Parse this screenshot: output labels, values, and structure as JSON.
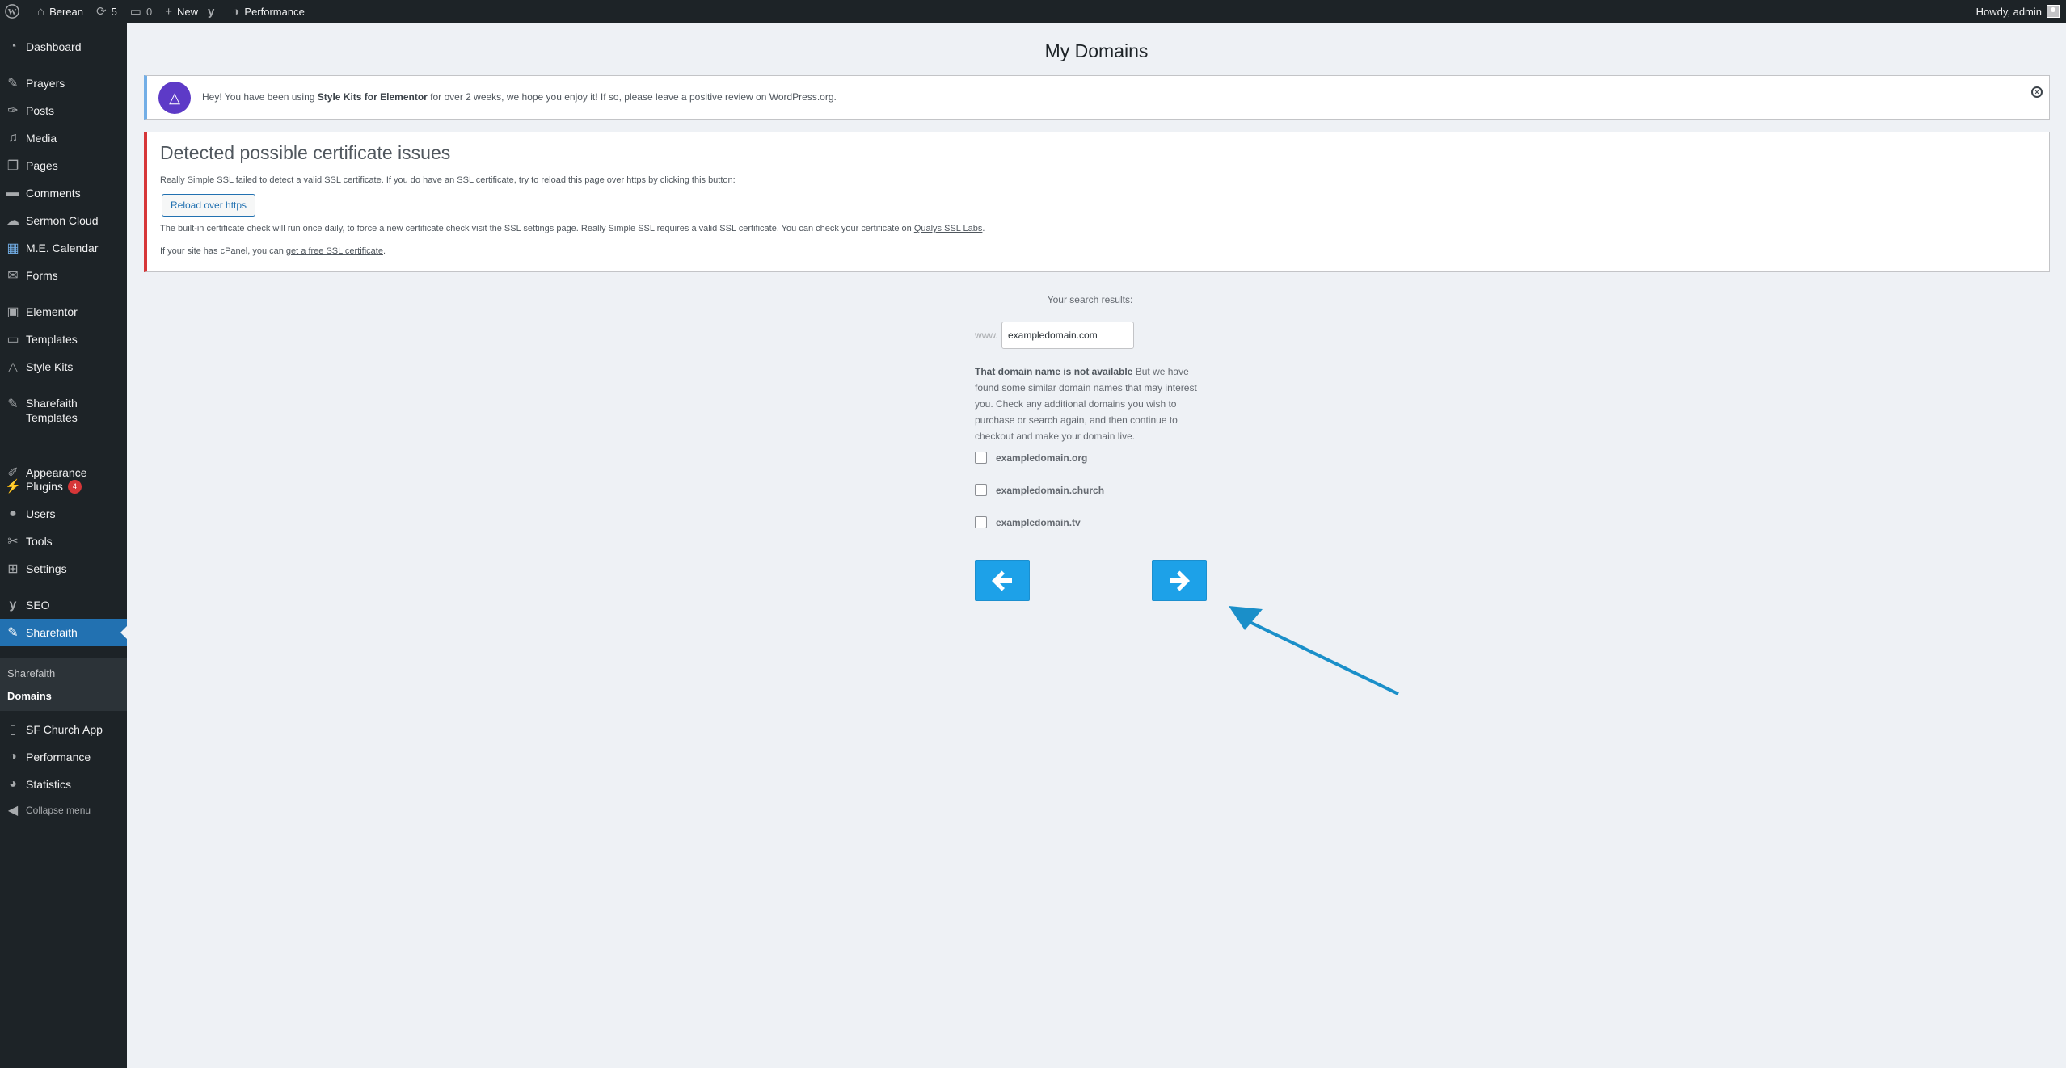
{
  "adminbar": {
    "site_name": "Berean",
    "updates_count": "5",
    "comments_count": "0",
    "new_label": "New",
    "performance_label": "Performance",
    "howdy": "Howdy, admin"
  },
  "sidebar": {
    "dashboard": "Dashboard",
    "prayers": "Prayers",
    "posts": "Posts",
    "media": "Media",
    "pages": "Pages",
    "comments": "Comments",
    "sermon_cloud": "Sermon Cloud",
    "me_calendar": "M.E. Calendar",
    "forms": "Forms",
    "elementor": "Elementor",
    "templates": "Templates",
    "style_kits": "Style Kits",
    "sharefaith_templates_1": "Sharefaith",
    "sharefaith_templates_2": "Templates",
    "appearance": "Appearance",
    "plugins": "Plugins",
    "plugins_badge": "4",
    "users": "Users",
    "tools": "Tools",
    "settings": "Settings",
    "seo": "SEO",
    "sharefaith": "Sharefaith",
    "sub_sharefaith": "Sharefaith",
    "sub_domains": "Domains",
    "sf_church_app": "SF Church App",
    "performance": "Performance",
    "statistics": "Statistics",
    "collapse": "Collapse menu"
  },
  "page": {
    "title": "My Domains"
  },
  "notice_stylekits": {
    "pre": "Hey! You have been using ",
    "bold": "Style Kits for Elementor",
    "post": " for over 2 weeks, we hope you enjoy it! If so, please leave a positive review on WordPress.org."
  },
  "notice_ssl": {
    "title": "Detected possible certificate issues",
    "p1": "Really Simple SSL failed to detect a valid SSL certificate. If you do have an SSL certificate, try to reload this page over https by clicking this button:",
    "reload_button": "Reload over https",
    "p2": "The built-in certificate check will run once daily, to force a new certificate check visit the SSL settings page. Really Simple SSL requires a valid SSL certificate. You can check your certificate on ",
    "p2_link": "Qualys SSL Labs",
    "p2_end": ".",
    "p3": "If your site has cPanel, you can ",
    "p3_link": "get a free SSL certificate",
    "p3_end": "."
  },
  "domain_search": {
    "results_label": "Your search results:",
    "prefix": "www.",
    "input_value": "exampledomain.com",
    "unavailable_bold": "That domain name is not available",
    "unavailable_text": " But we have found some similar domain names that may interest you. Check any additional domains you wish to purchase or search again, and then continue to checkout and make your domain live.",
    "options": [
      "exampledomain.org",
      "exampledomain.church",
      "exampledomain.tv"
    ]
  },
  "colors": {
    "admin_dark": "#1d2327",
    "active_blue": "#2271b1",
    "button_blue": "#1da1e8",
    "error_red": "#d63638",
    "info_blue": "#72aee6",
    "annotation_arrow": "#1a8fc9"
  }
}
